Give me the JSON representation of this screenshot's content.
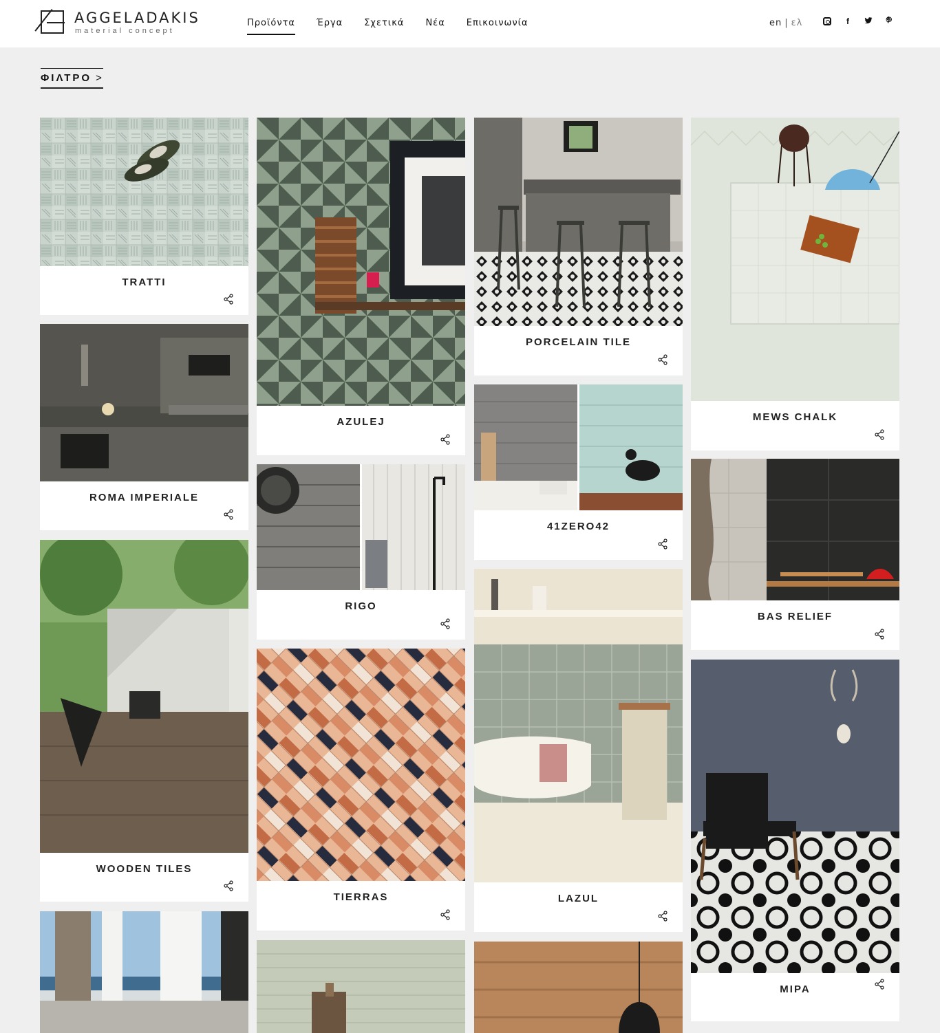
{
  "brand": {
    "name": "AGGELADAKIS",
    "tagline": "material concept"
  },
  "nav": [
    {
      "label": "Προϊόντα",
      "active": true
    },
    {
      "label": "Έργα",
      "active": false
    },
    {
      "label": "Σχετικά",
      "active": false
    },
    {
      "label": "Νέα",
      "active": false
    },
    {
      "label": "Επικοινωνία",
      "active": false
    }
  ],
  "lang": {
    "current": "en",
    "separator": "|",
    "other": "ελ"
  },
  "social": [
    "instagram-icon",
    "facebook-icon",
    "twitter-icon",
    "pinterest-icon"
  ],
  "filter": {
    "label": "ΦΙΛΤΡΟ",
    "chevron": ">"
  },
  "products": [
    {
      "title": "TRATTI"
    },
    {
      "title": "ROMA IMPERIALE"
    },
    {
      "title": "WOODEN TILES"
    },
    {
      "title": ""
    },
    {
      "title": "AZULEJ"
    },
    {
      "title": "RIGO"
    },
    {
      "title": "TIERRAS"
    },
    {
      "title": ""
    },
    {
      "title": "PORCELAIN TILE"
    },
    {
      "title": "41ZERO42"
    },
    {
      "title": "LAZUL"
    },
    {
      "title": ""
    },
    {
      "title": "MEWS CHALK"
    },
    {
      "title": "BAS RELIEF"
    },
    {
      "title": "MIPA"
    }
  ]
}
